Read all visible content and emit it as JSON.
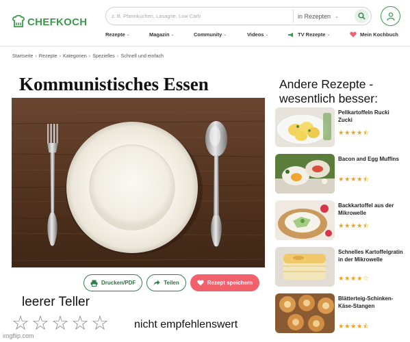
{
  "header": {
    "logo_text": "CHEFKOCH",
    "search": {
      "placeholder": "z. B. Pfannkuchen, Lasagne, Low Carb",
      "scope": "in Rezepten"
    },
    "nav": [
      {
        "label": "Rezepte"
      },
      {
        "label": "Magazin"
      },
      {
        "label": "Community"
      },
      {
        "label": "Videos"
      },
      {
        "label": "TV Rezepte"
      },
      {
        "label": "Mein Kochbuch"
      }
    ]
  },
  "breadcrumb": [
    "Startseite",
    "Rezepte",
    "Kategorien",
    "Spezielles",
    "Schnell und einfach"
  ],
  "recipe": {
    "title": "Kommunistisches Essen",
    "actions": {
      "print": "Drucken/PDF",
      "share": "Teilen",
      "save": "Rezept speichern"
    },
    "caption": "leerer Teller",
    "rating_stars": 0,
    "rating_max": 5,
    "verdict": "nicht empfehlenswert"
  },
  "sidebar": {
    "heading": "Andere Rezepte - wesentlich besser:",
    "items": [
      {
        "title": "Pellkartoffeln Rucki Zucki",
        "rating": 4.5
      },
      {
        "title": "Bacon and Egg Muffins",
        "rating": 4.5
      },
      {
        "title": "Backkartoffel aus der Mikrowelle",
        "rating": 4.5
      },
      {
        "title": "Schnelles Kartoffelgratin in der Mikrowelle",
        "rating": 4
      },
      {
        "title": "Blätterteig-Schinken-Käse-Stangen",
        "rating": 4.5
      }
    ]
  },
  "watermark": "imgflip.com",
  "colors": {
    "brand_green": "#3a9a4a",
    "save_red": "#f0616b",
    "star_gold": "#e9a31c",
    "wood": "#5b3a26"
  }
}
